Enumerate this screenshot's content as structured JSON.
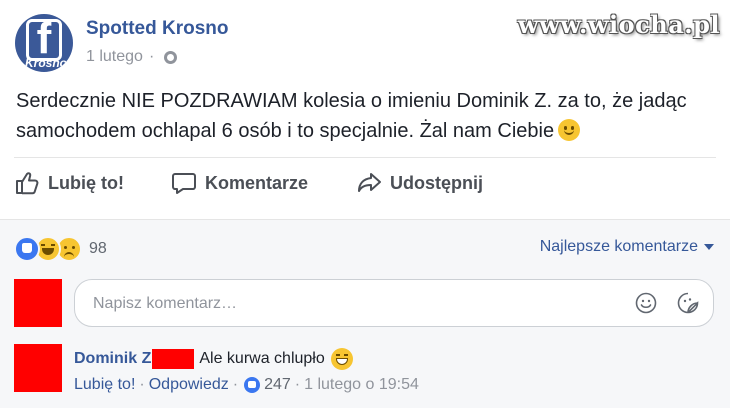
{
  "watermark": "www.wiocha.pl",
  "page": {
    "avatar_letter": "f",
    "avatar_caption": "Krosno",
    "name": "Spotted Krosno",
    "date": "1 lutego",
    "separator": "·"
  },
  "post": {
    "text": "Serdecznie NIE POZDRAWIAM kolesia o imieniu Dominik Z. za to, że jadąc samochodem ochlapal 6 osób i to specjalnie. Żal nam Ciebie"
  },
  "actions": {
    "like": "Lubię to!",
    "comment": "Komentarze",
    "share": "Udostępnij"
  },
  "reactions": {
    "count": "98",
    "sort_label": "Najlepsze komentarze"
  },
  "comment_box": {
    "placeholder": "Napisz komentarz…"
  },
  "comment": {
    "author": "Dominik Z",
    "text": "Ale kurwa chlupło",
    "like": "Lubię to!",
    "reply": "Odpowiedz",
    "separator": "·",
    "like_count": "247",
    "time": "1 lutego o 19:54"
  },
  "colors": {
    "link": "#365899",
    "muted": "#90949c",
    "redaction": "#ff0000",
    "like_blue": "#3b77f0"
  }
}
